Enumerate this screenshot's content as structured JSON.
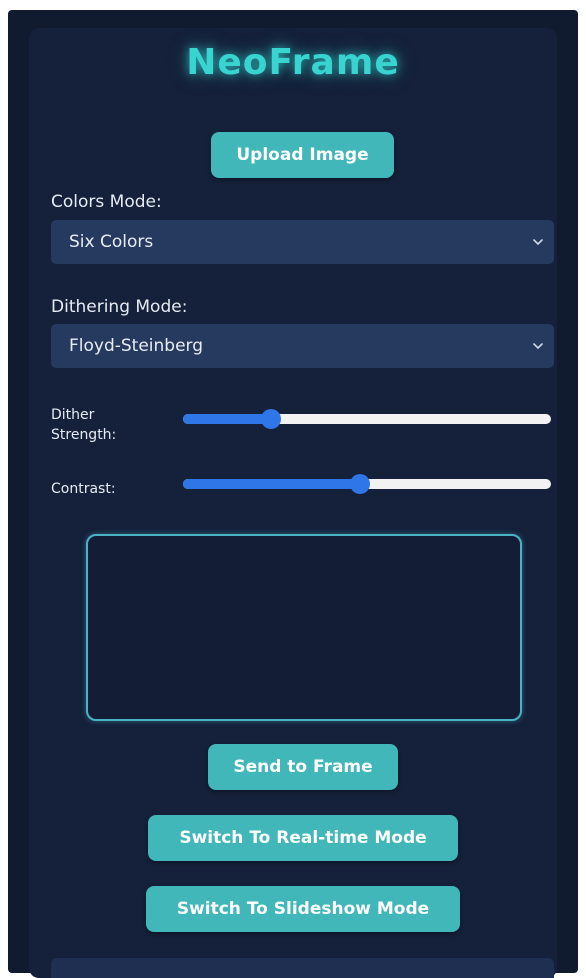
{
  "app": {
    "title": "NeoFrame",
    "accent_color": "#41b7b9",
    "title_color": "#37d4d0",
    "background_color": "#15203a"
  },
  "upload": {
    "label": "Upload Image"
  },
  "colors_mode": {
    "label": "Colors Mode:",
    "selected": "Six Colors",
    "icon": "chevron-down-icon"
  },
  "dithering_mode": {
    "label": "Dithering Mode:",
    "selected": "Floyd-Steinberg",
    "icon": "chevron-down-icon"
  },
  "sliders": {
    "dither_strength": {
      "label_line1": "Dither",
      "label_line2": "Strength:",
      "value_fraction": 0.24
    },
    "contrast": {
      "label": "Contrast:",
      "value_fraction": 0.48
    }
  },
  "actions": {
    "send_label": "Send to Frame",
    "realtime_label": "Switch To Real-time Mode",
    "slideshow_label": "Switch To Slideshow Mode"
  }
}
